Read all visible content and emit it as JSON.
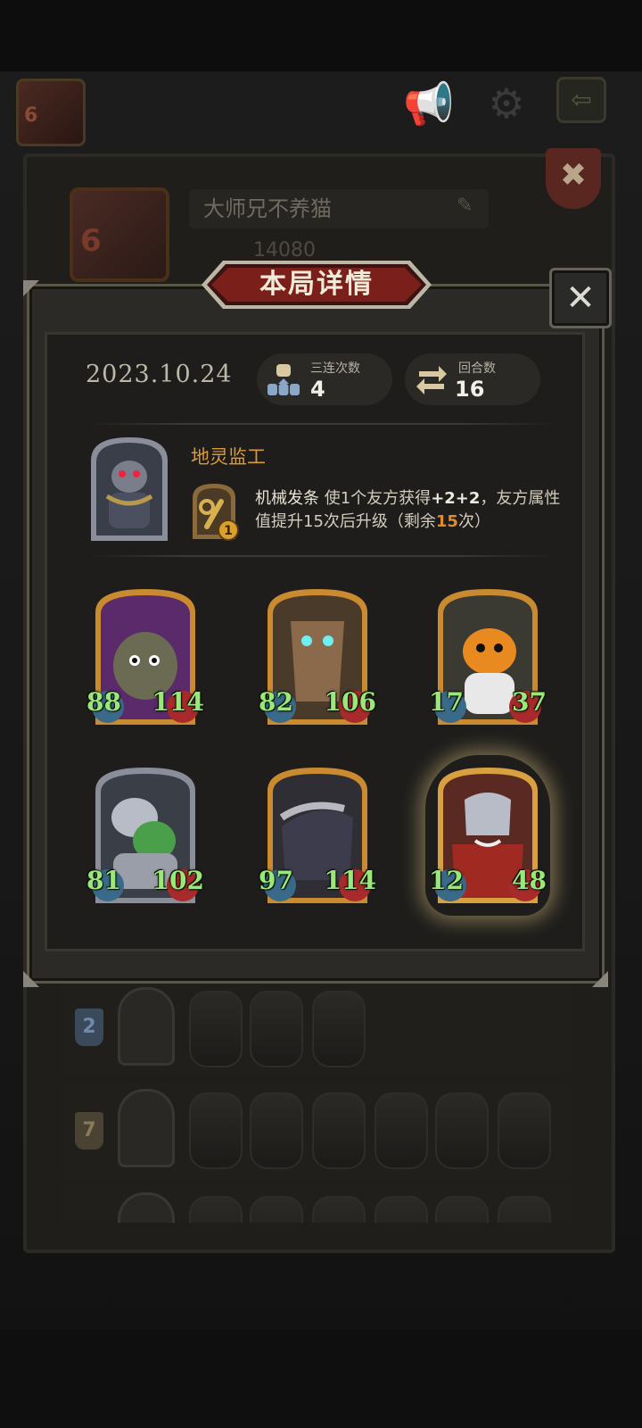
{
  "profile": {
    "avatar_level": "6",
    "player_name": "大师兄不养猫",
    "score": "14080"
  },
  "modal": {
    "title": "本局详情",
    "date": "2023.10.24",
    "stats": [
      {
        "label": "三连次数",
        "value": "4",
        "icon": "triple-merge-icon"
      },
      {
        "label": "回合数",
        "value": "16",
        "icon": "rounds-cycle-icon"
      }
    ],
    "boss": {
      "name": "地灵监工",
      "item_badge": "1",
      "skill_name": "机械发条",
      "skill_text_1": "使1个友方获得",
      "skill_bonus": "+2+2",
      "skill_text_2": "，友方属性",
      "skill_line2_a": "值提升15次后升级（剩余",
      "skill_remaining": "15",
      "skill_line2_b": "次）"
    },
    "cards": [
      {
        "name": "rock-golem",
        "attack": "88",
        "health": "114",
        "tier": "gold",
        "bg": "#5a2a6a"
      },
      {
        "name": "treant",
        "attack": "82",
        "health": "106",
        "tier": "gold",
        "bg": "#4a3a2a"
      },
      {
        "name": "pumpkin-ghost",
        "attack": "17",
        "health": "37",
        "tier": "gold",
        "bg": "#3a3a32"
      },
      {
        "name": "goblin-knight",
        "attack": "81",
        "health": "102",
        "tier": "silver",
        "bg": "#3a3e46"
      },
      {
        "name": "shadow-steed",
        "attack": "97",
        "health": "114",
        "tier": "gold",
        "bg": "#2e2e34"
      },
      {
        "name": "red-warrior",
        "attack": "12",
        "health": "48",
        "tier": "gold-glow",
        "bg": "#5a2a22"
      }
    ]
  },
  "history": [
    {
      "rank": "2",
      "rank_color": "#4a6a8a",
      "cards": 3
    },
    {
      "rank": "7",
      "rank_color": "#8a7a5a",
      "cards": 6
    }
  ],
  "colors": {
    "banner_red": "#7a1f1a",
    "gold_frame": "#c98a30",
    "silver_frame": "#8a8e9a",
    "attack_text": "#9be87a",
    "boss_name": "#d89a3a"
  }
}
